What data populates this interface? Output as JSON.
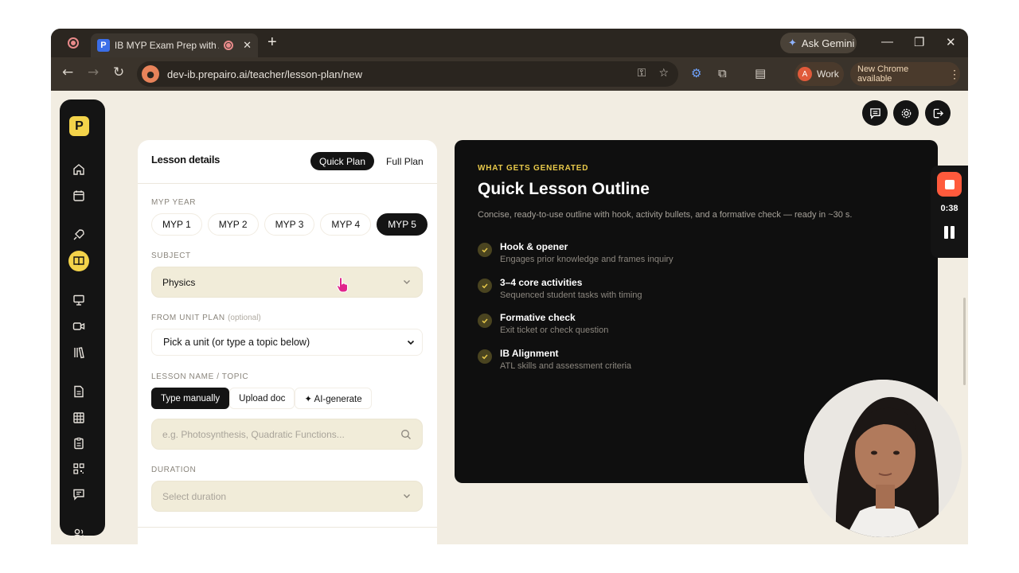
{
  "browser": {
    "tab_title": "IB MYP Exam Prep with AI |",
    "tab_favicon": "P",
    "new_tab": "+",
    "ask_gemini": "Ask Gemini",
    "url": "dev-ib.prepairo.ai/teacher/lesson-plan/new",
    "profile_initial": "A",
    "profile_label": "Work",
    "update_label": "New Chrome available"
  },
  "sidebar": {
    "logo": "P",
    "items": [
      "home-icon",
      "calendar-icon",
      "rocket-icon",
      "book-icon",
      "presentation-icon",
      "video-icon",
      "library-icon",
      "document-icon",
      "grid-icon",
      "clipboard-icon",
      "qr-icon",
      "message-icon",
      "users-icon"
    ],
    "active_item": "book-icon"
  },
  "top_actions": [
    "feedback-icon",
    "settings-icon",
    "logout-icon"
  ],
  "lesson": {
    "title": "Lesson details",
    "plan_options": [
      "Quick Plan",
      "Full Plan"
    ],
    "plan_selected": "Quick Plan",
    "myp_year_label": "MYP YEAR",
    "myp_years": [
      "MYP 1",
      "MYP 2",
      "MYP 3",
      "MYP 4",
      "MYP 5"
    ],
    "myp_selected": "MYP 5",
    "subject_label": "SUBJECT",
    "subject_value": "Physics",
    "unit_label": "FROM UNIT PLAN",
    "unit_optional": "(optional)",
    "unit_value": "Pick a unit (or type a topic below)",
    "topic_label": "LESSON NAME / TOPIC",
    "topic_modes": [
      "Type manually",
      "Upload doc",
      "✦ AI-generate"
    ],
    "topic_mode_selected": "Type manually",
    "topic_placeholder": "e.g. Photosynthesis, Quadratic Functions...",
    "duration_label": "DURATION",
    "duration_placeholder": "Select duration"
  },
  "info": {
    "kicker": "WHAT GETS GENERATED",
    "title": "Quick Lesson Outline",
    "description": "Concise, ready-to-use outline with hook, activity bullets, and a formative check — ready in ~30 s.",
    "features": [
      {
        "title": "Hook & opener",
        "subtitle": "Engages prior knowledge and frames inquiry"
      },
      {
        "title": "3–4 core activities",
        "subtitle": "Sequenced student tasks with timing"
      },
      {
        "title": "Formative check",
        "subtitle": "Exit ticket or check question"
      },
      {
        "title": "IB Alignment",
        "subtitle": "ATL skills and assessment criteria"
      }
    ]
  },
  "recorder": {
    "time": "0:38"
  },
  "colors": {
    "accent": "#f3d34a",
    "page_bg": "#f2ede2",
    "dark": "#141414",
    "record": "#ff5a3c"
  }
}
